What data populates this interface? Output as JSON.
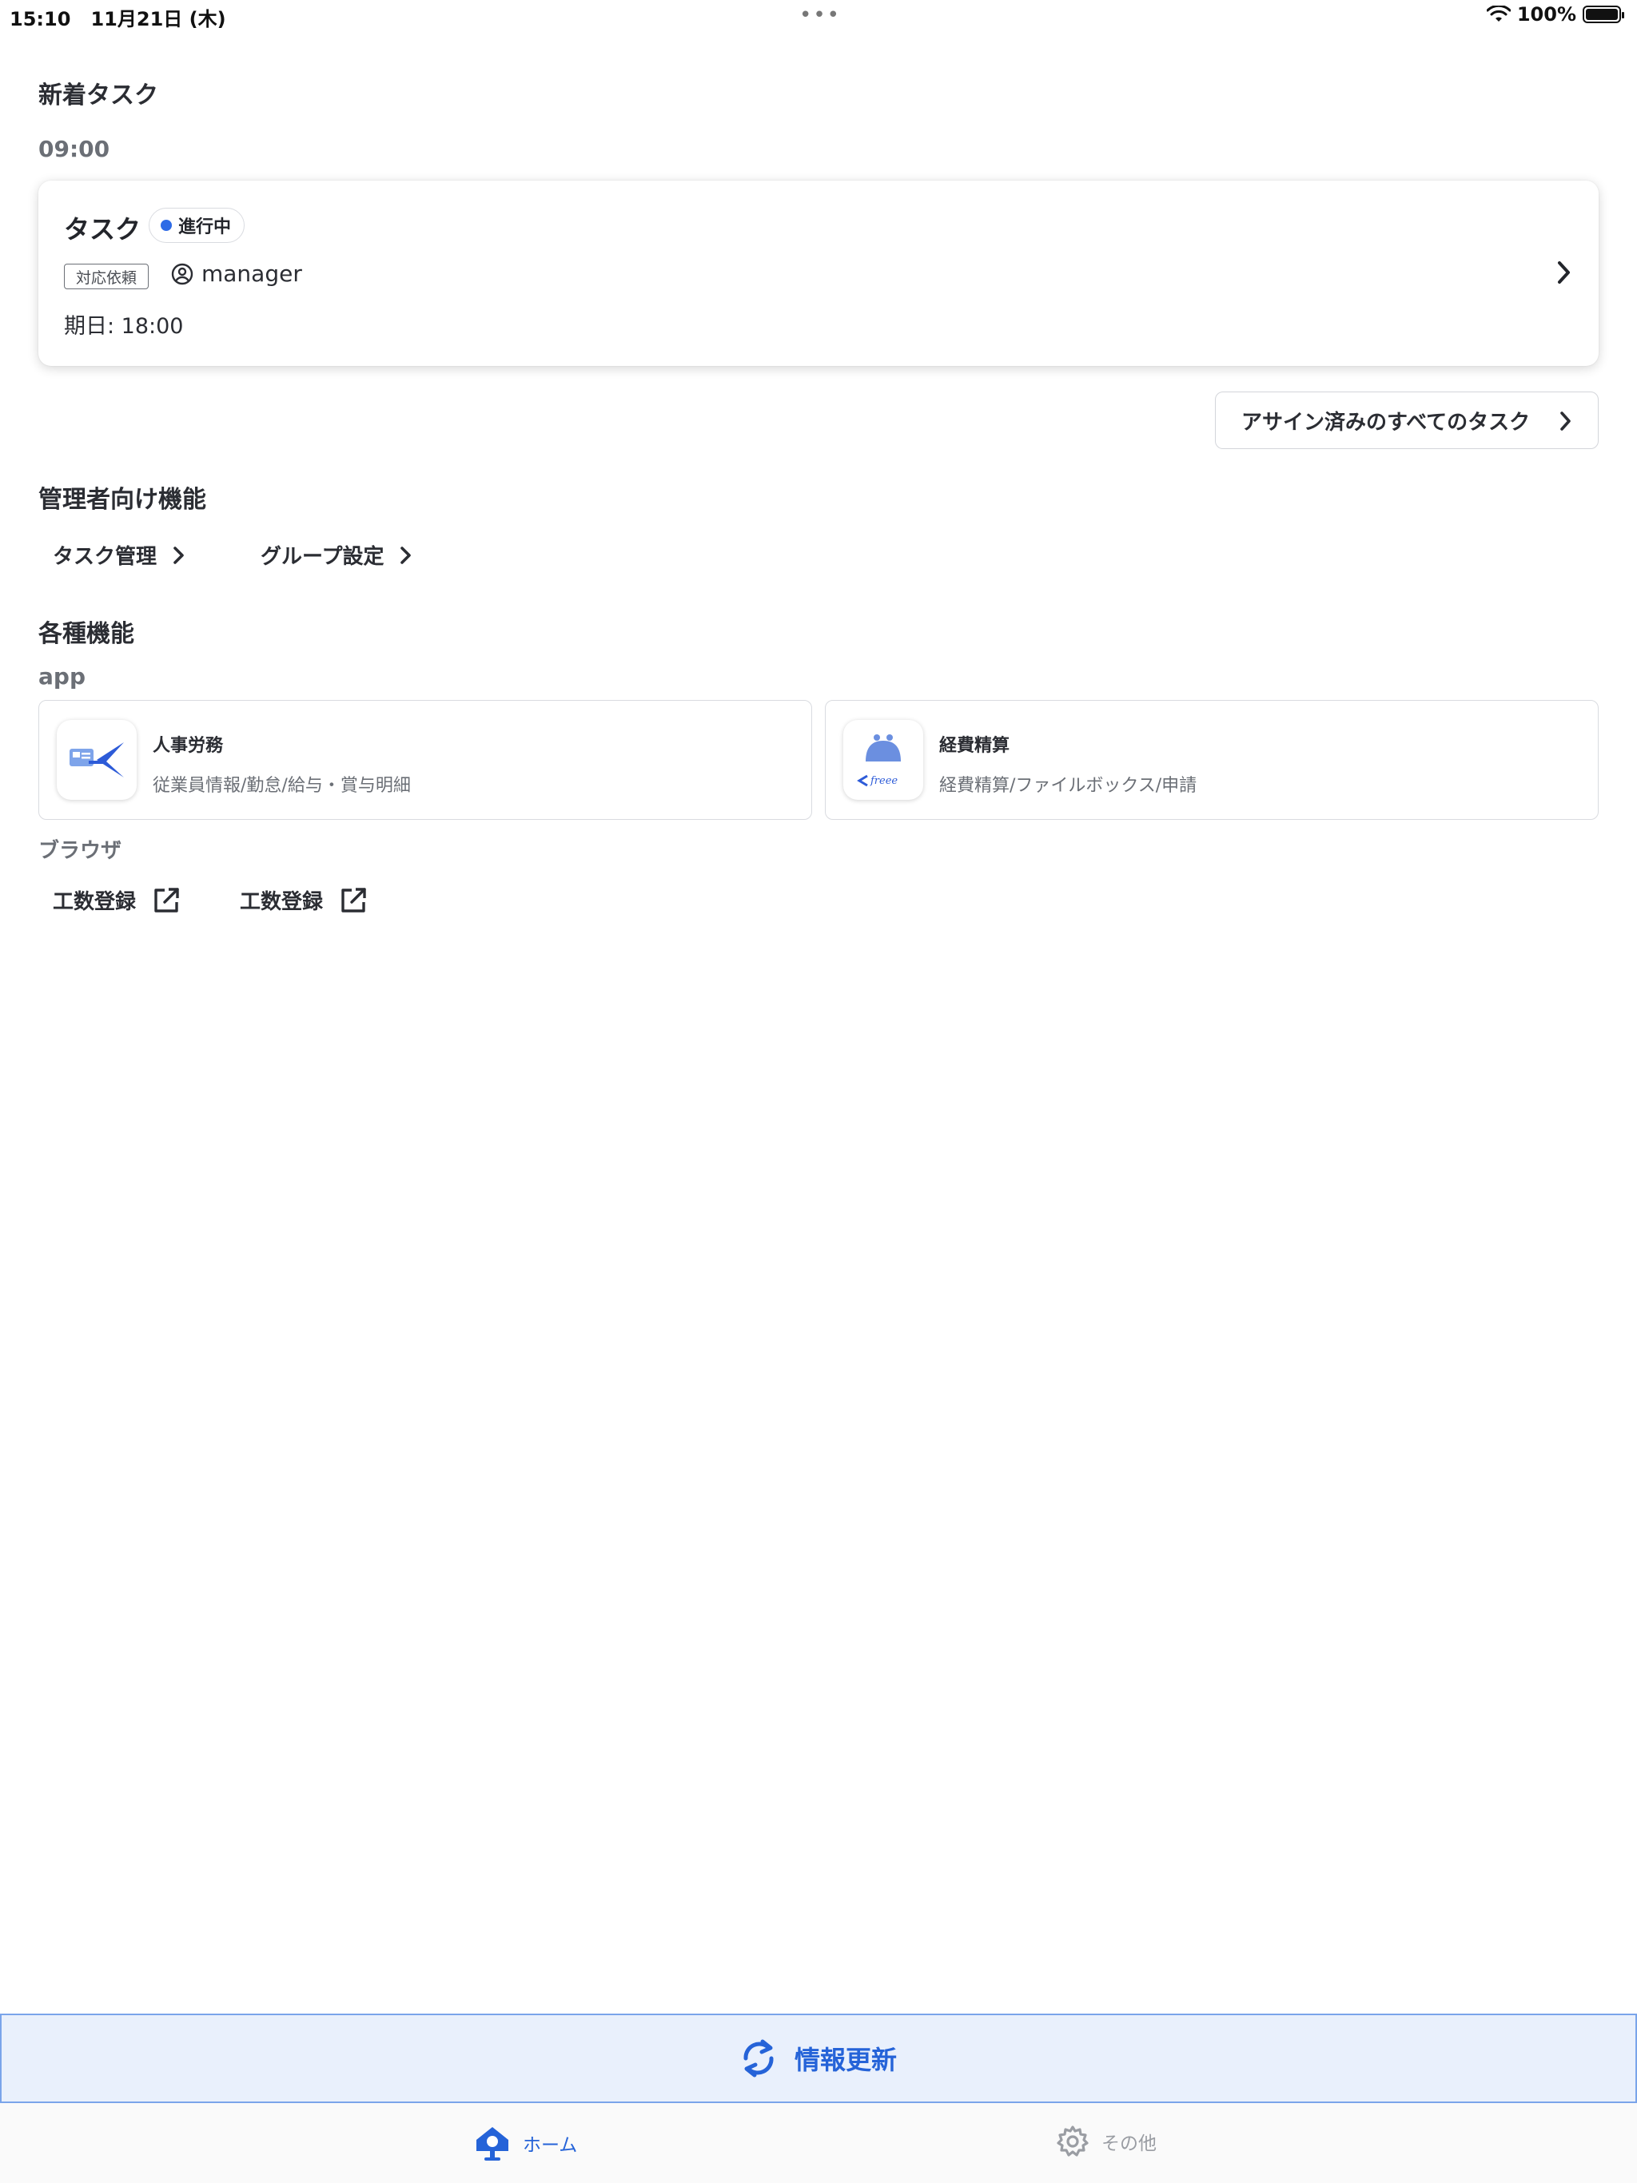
{
  "status_bar": {
    "time": "15:10",
    "date": "11月21日 (木)",
    "battery": "100%"
  },
  "new_tasks": {
    "heading": "新着タスク",
    "time_group": "09:00",
    "task": {
      "title": "タスク",
      "status": "進行中",
      "status_color": "#2e6be6",
      "tag": "対応依頼",
      "assignee": "manager",
      "due": "期日: 18:00"
    },
    "all_tasks_button": "アサイン済みのすべてのタスク"
  },
  "admin": {
    "heading": "管理者向け機能",
    "links": [
      {
        "label": "タスク管理"
      },
      {
        "label": "グループ設定"
      }
    ]
  },
  "features": {
    "heading": "各種機能",
    "app_heading": "app",
    "apps": [
      {
        "name": "人事労務",
        "desc": "従業員情報/勤怠/給与・賞与明細",
        "icon": "freee-hr-icon"
      },
      {
        "name": "経費精算",
        "desc": "経費精算/ファイルボックス/申請",
        "icon": "freee-expense-icon"
      }
    ],
    "browser_heading": "ブラウザ",
    "browser_links": [
      {
        "label": "工数登録"
      },
      {
        "label": "工数登録"
      }
    ]
  },
  "refresh_button": "情報更新",
  "accent_color": "#2563d8",
  "tabs": [
    {
      "label": "ホーム",
      "active": true
    },
    {
      "label": "その他",
      "active": false
    }
  ]
}
